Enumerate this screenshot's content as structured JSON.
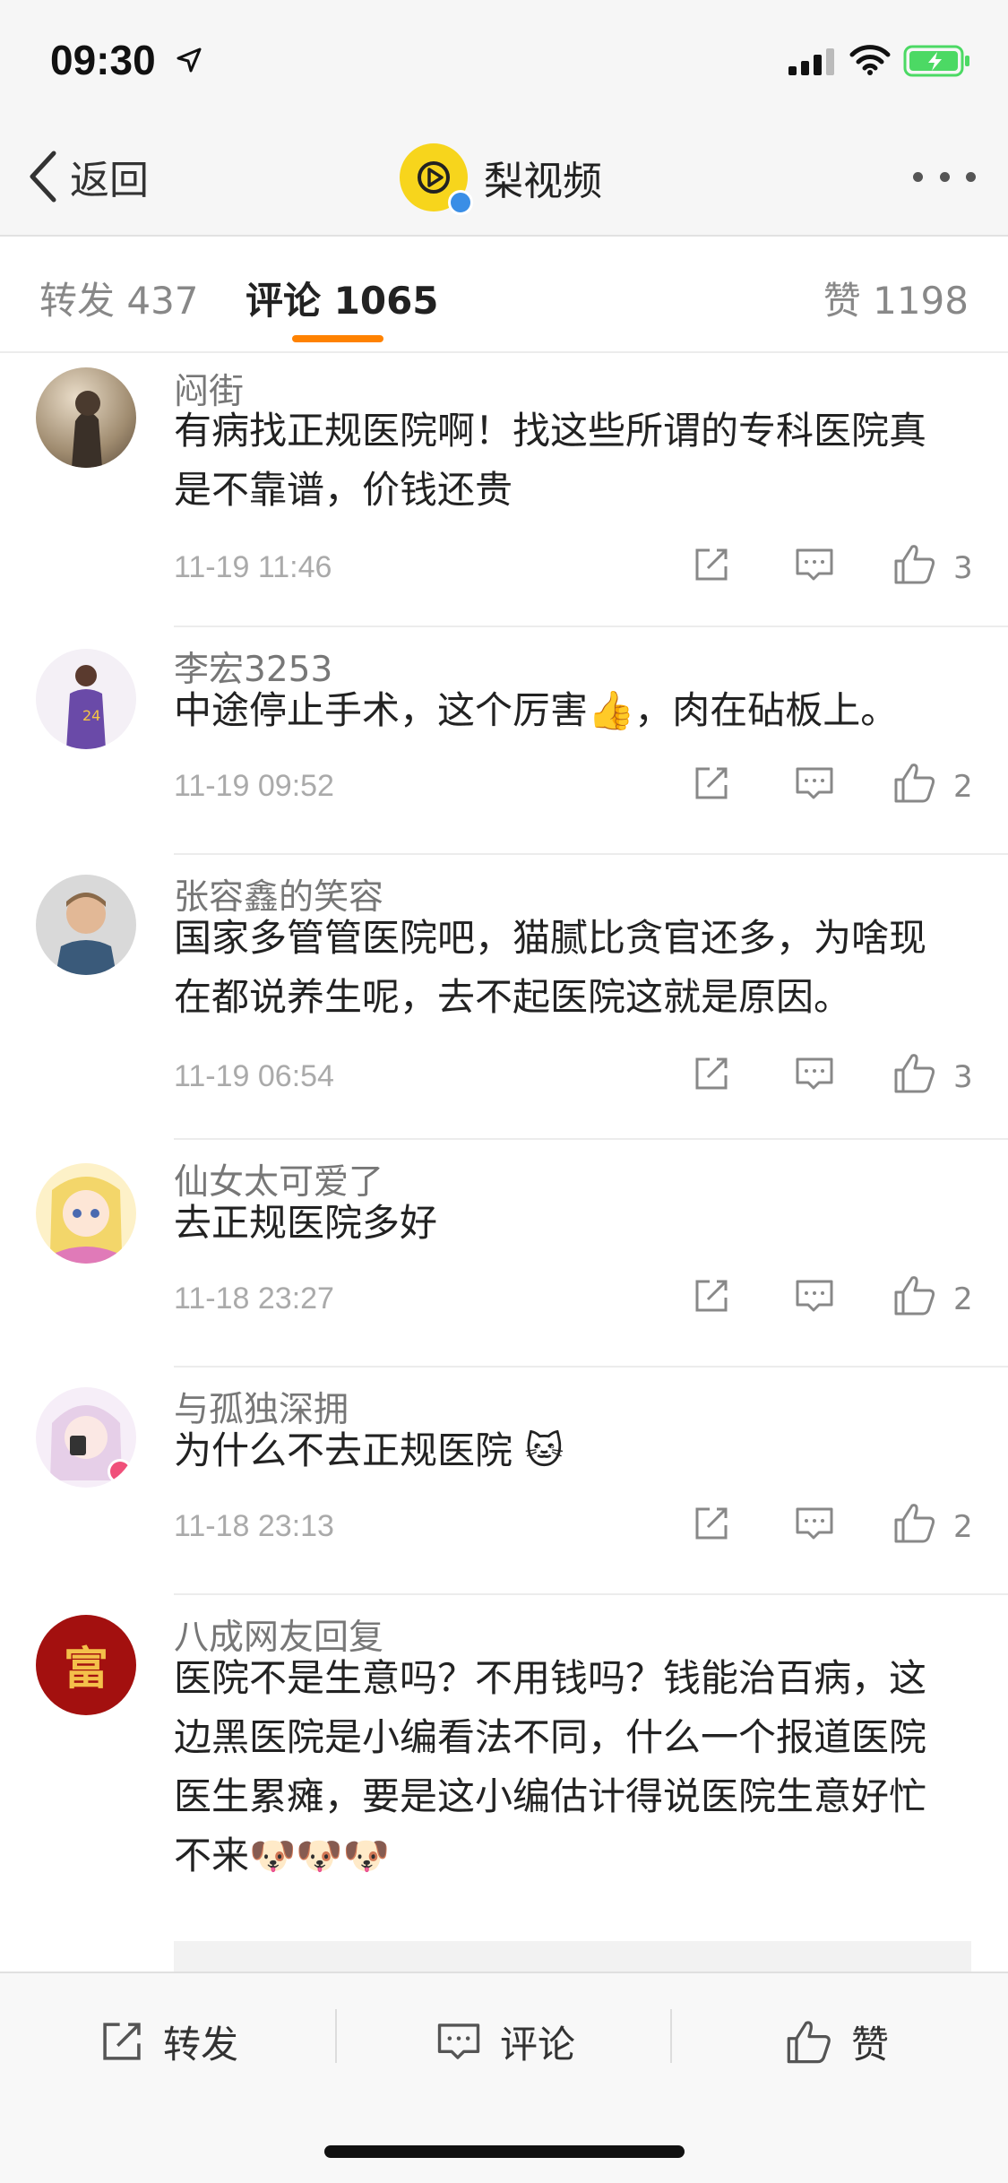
{
  "status_bar": {
    "time": "09:30"
  },
  "nav": {
    "back_label": "返回",
    "title": "梨视频"
  },
  "tabs": {
    "repost": "转发 437",
    "comment": "评论 1065",
    "like": "赞 1198"
  },
  "comments": [
    {
      "user": "闷街",
      "text": "有病找正规医院啊！找这些所谓的专科医院真是不靠谱，价钱还贵",
      "time": "11-19 11:46",
      "likes": "3"
    },
    {
      "user": "李宏3253",
      "text": "中途停止手术，这个厉害👍，肉在砧板上。",
      "time": "11-19 09:52",
      "likes": "2"
    },
    {
      "user": "张容鑫的笑容",
      "text": "国家多管管医院吧，猫腻比贪官还多，为啥现在都说养生呢，去不起医院这就是原因。",
      "time": "11-19 06:54",
      "likes": "3"
    },
    {
      "user": "仙女太可爱了",
      "text": "去正规医院多好",
      "time": "11-18 23:27",
      "likes": "2"
    },
    {
      "user": "与孤独深拥",
      "text": "为什么不去正规医院 🐱",
      "time": "11-18 23:13",
      "likes": "2"
    },
    {
      "user": "八成网友回复",
      "text": "医院不是生意吗？不用钱吗？钱能治百病，这边黑医院是小编看法不同，什么一个报道医院医生累瘫，要是这小编估计得说医院生意好忙不来🐶🐶🐶",
      "avatar_char": "富"
    }
  ],
  "bottom": {
    "repost": "转发",
    "comment": "评论",
    "like": "赞"
  },
  "colors": {
    "accent": "#ff8200",
    "channel_yellow": "#f7d51c",
    "verified_blue": "#3a8ee6"
  }
}
